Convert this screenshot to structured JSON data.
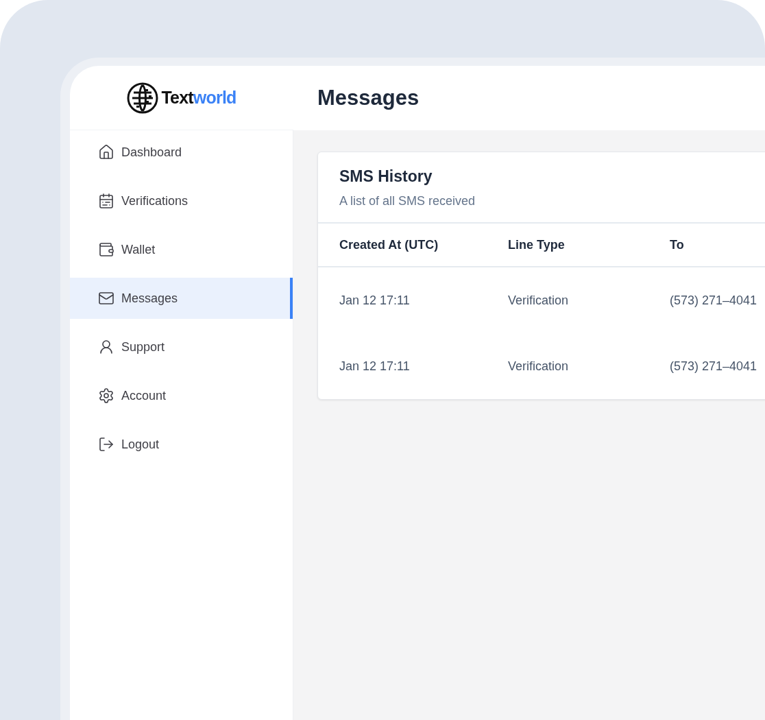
{
  "logo": {
    "name_part_1": "Text",
    "name_part_2": "world"
  },
  "page_title": "Messages",
  "sidebar": {
    "items": [
      {
        "label": "Dashboard",
        "selected": false
      },
      {
        "label": "Verifications",
        "selected": false
      },
      {
        "label": "Wallet",
        "selected": false
      },
      {
        "label": "Messages",
        "selected": true
      },
      {
        "label": "Support",
        "selected": false
      },
      {
        "label": "Account",
        "selected": false
      },
      {
        "label": "Logout",
        "selected": false
      }
    ]
  },
  "card": {
    "title": "SMS History",
    "subtitle": "A list of all SMS received",
    "table": {
      "columns": [
        "Created At (UTC)",
        "Line Type",
        "To"
      ],
      "rows": [
        [
          "Jan 12 17:11",
          "Verification",
          "(573) 271–4041"
        ],
        [
          "Jan 12 17:11",
          "Verification",
          "(573) 271–4041"
        ]
      ]
    }
  }
}
